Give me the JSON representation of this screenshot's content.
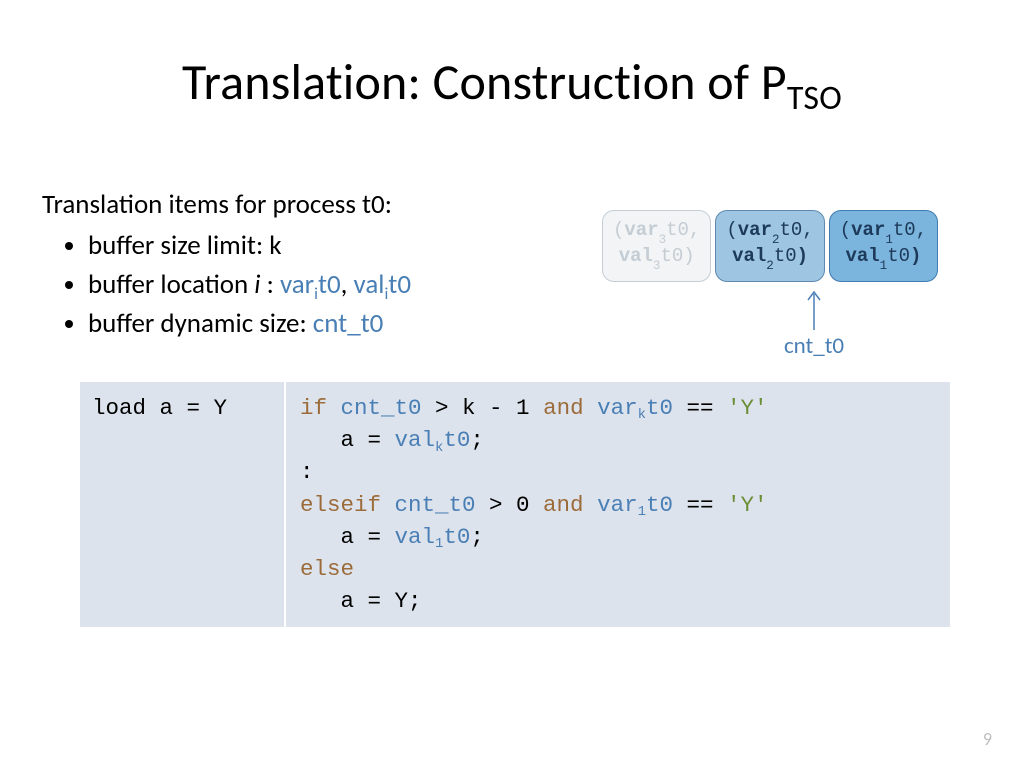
{
  "title": {
    "main": "Translation: Construction of P",
    "sub": "TSO"
  },
  "intro": {
    "lead": "Translation items for process t0:",
    "b1": "buffer size limit: k",
    "b2_pre": "buffer location ",
    "b2_i": "i",
    "b2_sep": " :  ",
    "b2_var": "var",
    "b2_isub": "i",
    "b2_t0a": "t0",
    "b2_comma": ", ",
    "b2_val": "val",
    "b2_t0b": "t0",
    "b3_pre": "buffer dynamic size: ",
    "b3_cnt": "cnt_t0"
  },
  "cells": {
    "c3": {
      "open": "(",
      "var": "var",
      "s": "3",
      "t": "t0",
      "comma": ",",
      "val": "val",
      "close": ")"
    },
    "c2": {
      "open": "(",
      "var": "var",
      "s": "2",
      "t": "t0",
      "comma": ",",
      "val": "val",
      "close": ")"
    },
    "c1": {
      "open": "(",
      "var": "var",
      "s": "1",
      "t": "t0",
      "comma": ",",
      "val": "val",
      "close": ")"
    }
  },
  "arrow_label": "cnt_t0",
  "code": {
    "left": "load a = Y",
    "r": {
      "l1_if": "if ",
      "l1_cnt": "cnt_t0",
      "l1_gt": " > k - 1 ",
      "l1_and": "and ",
      "l1_var": "var",
      "l1_k": "k",
      "l1_t0": "t0",
      "l1_eq": " == ",
      "l1_y": "'Y'",
      "l2_pre": "   a = ",
      "l2_val": "val",
      "l2_k": "k",
      "l2_t0": "t0",
      "l2_semi": ";",
      "l3": ":",
      "l4_elif": "elseif ",
      "l4_cnt": "cnt_t0",
      "l4_gt": " > 0 ",
      "l4_and": "and ",
      "l4_var": "var",
      "l4_1": "1",
      "l4_t0": "t0",
      "l4_eq": " == ",
      "l4_y": "'Y'",
      "l5_pre": "   a = ",
      "l5_val": "val",
      "l5_1": "1",
      "l5_t0": "t0",
      "l5_semi": ";",
      "l6_else": "else",
      "l7": "   a = Y;"
    }
  },
  "pagenum": "9"
}
